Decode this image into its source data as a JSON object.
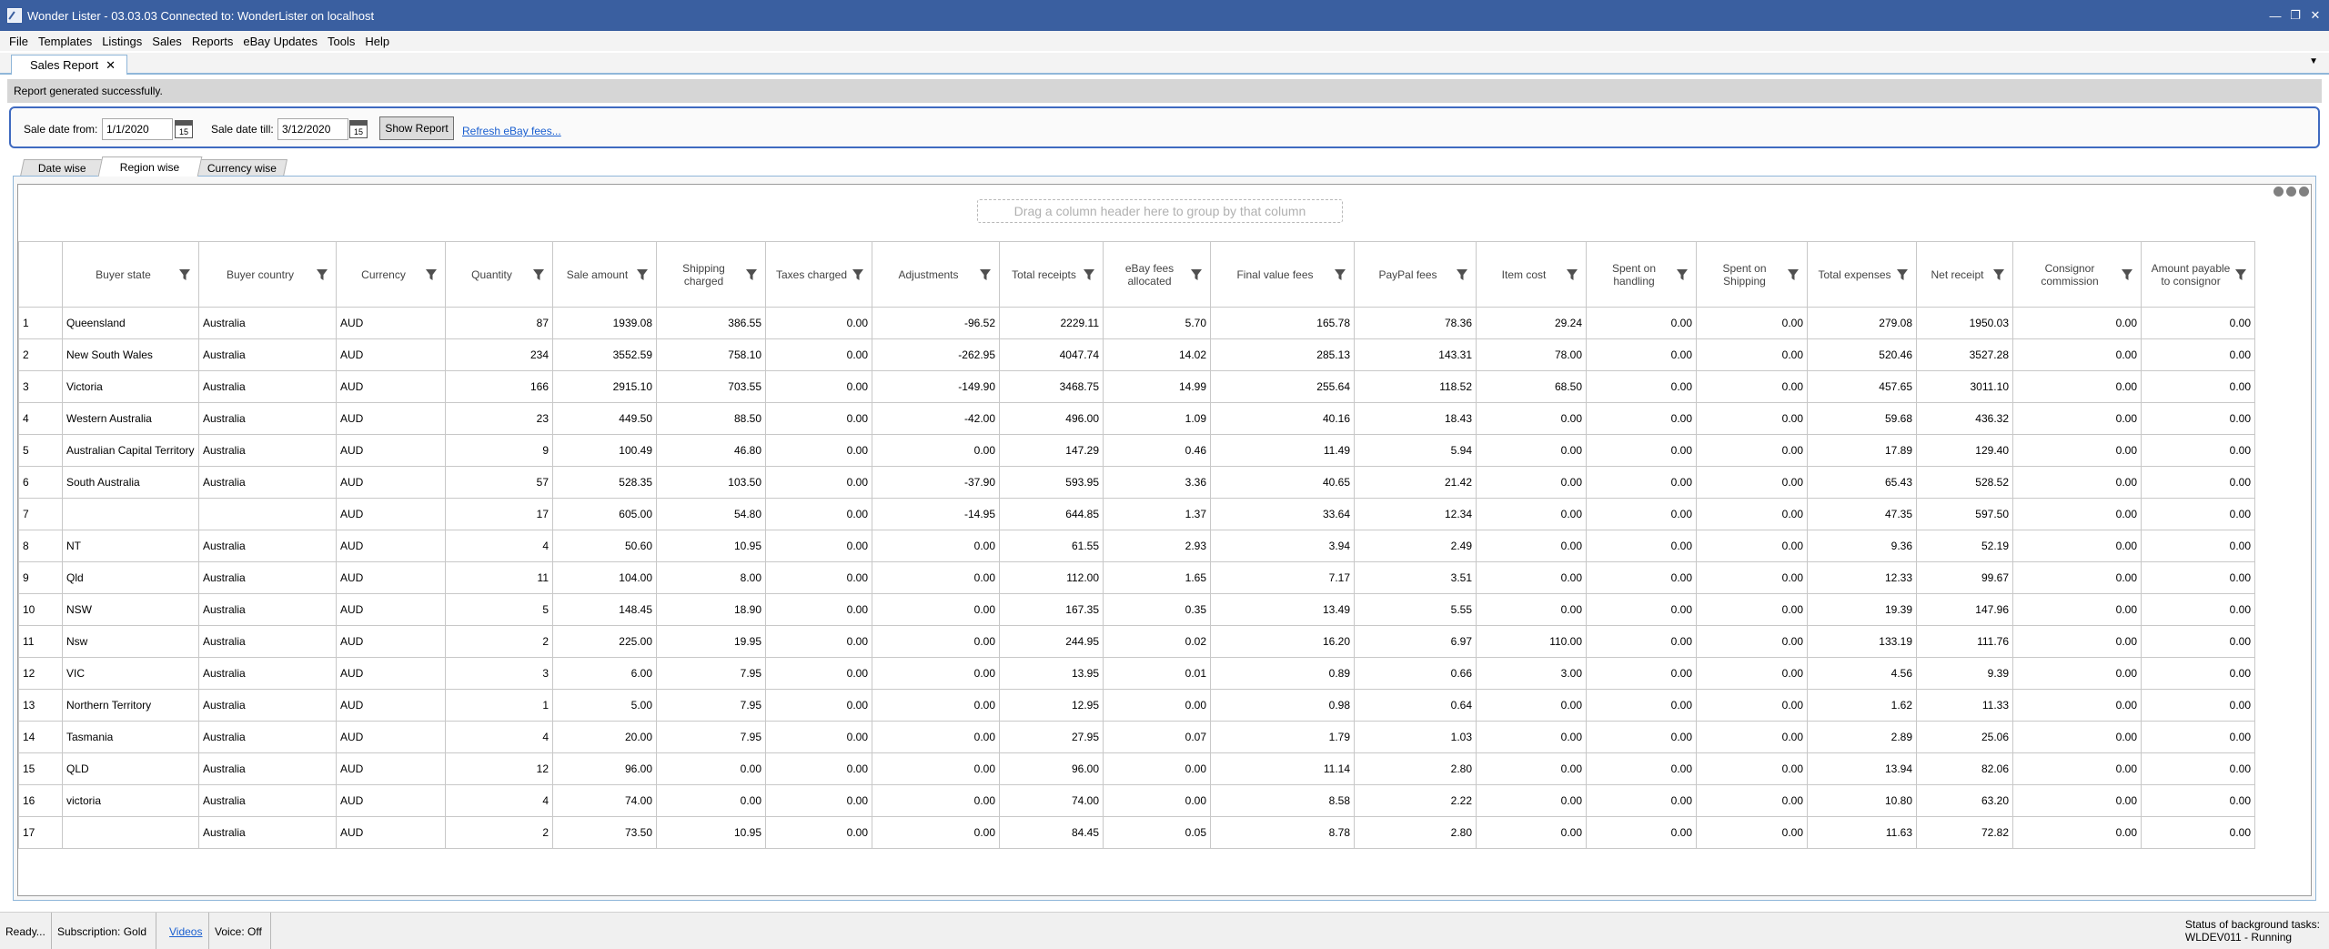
{
  "window": {
    "title": "Wonder Lister - 03.03.03 Connected to: WonderLister on localhost"
  },
  "menu": [
    "File",
    "Templates",
    "Listings",
    "Sales",
    "Reports",
    "eBay Updates",
    "Tools",
    "Help"
  ],
  "doc_tab": {
    "label": "Sales Report",
    "close": "✕"
  },
  "status_message": "Report generated successfully.",
  "filters": {
    "from_label": "Sale date from:",
    "from_value": "1/1/2020",
    "till_label": "Sale date till:",
    "till_value": "3/12/2020",
    "calendar_glyph": "15",
    "show_report": "Show Report",
    "refresh_link": "Refresh eBay fees..."
  },
  "report_tabs": [
    "Date wise",
    "Region wise",
    "Currency wise"
  ],
  "active_report_tab": "Region wise",
  "grid": {
    "group_hint": "Drag a column header here to group by that column",
    "columns": [
      "Buyer state",
      "Buyer country",
      "Currency",
      "Quantity",
      "Sale amount",
      "Shipping charged",
      "Taxes charged",
      "Adjustments",
      "Total receipts",
      "eBay fees allocated",
      "Final value fees",
      "PayPal fees",
      "Item cost",
      "Spent on handling",
      "Spent on Shipping",
      "Total expenses",
      "Net receipt",
      "Consignor commission",
      "Amount payable to consignor"
    ],
    "rows": [
      [
        "1",
        "Queensland",
        "Australia",
        "AUD",
        "87",
        "1939.08",
        "386.55",
        "0.00",
        "-96.52",
        "2229.11",
        "5.70",
        "165.78",
        "78.36",
        "29.24",
        "0.00",
        "0.00",
        "279.08",
        "1950.03",
        "0.00",
        "0.00"
      ],
      [
        "2",
        "New South Wales",
        "Australia",
        "AUD",
        "234",
        "3552.59",
        "758.10",
        "0.00",
        "-262.95",
        "4047.74",
        "14.02",
        "285.13",
        "143.31",
        "78.00",
        "0.00",
        "0.00",
        "520.46",
        "3527.28",
        "0.00",
        "0.00"
      ],
      [
        "3",
        "Victoria",
        "Australia",
        "AUD",
        "166",
        "2915.10",
        "703.55",
        "0.00",
        "-149.90",
        "3468.75",
        "14.99",
        "255.64",
        "118.52",
        "68.50",
        "0.00",
        "0.00",
        "457.65",
        "3011.10",
        "0.00",
        "0.00"
      ],
      [
        "4",
        "Western Australia",
        "Australia",
        "AUD",
        "23",
        "449.50",
        "88.50",
        "0.00",
        "-42.00",
        "496.00",
        "1.09",
        "40.16",
        "18.43",
        "0.00",
        "0.00",
        "0.00",
        "59.68",
        "436.32",
        "0.00",
        "0.00"
      ],
      [
        "5",
        "Australian Capital Territory",
        "Australia",
        "AUD",
        "9",
        "100.49",
        "46.80",
        "0.00",
        "0.00",
        "147.29",
        "0.46",
        "11.49",
        "5.94",
        "0.00",
        "0.00",
        "0.00",
        "17.89",
        "129.40",
        "0.00",
        "0.00"
      ],
      [
        "6",
        "South Australia",
        "Australia",
        "AUD",
        "57",
        "528.35",
        "103.50",
        "0.00",
        "-37.90",
        "593.95",
        "3.36",
        "40.65",
        "21.42",
        "0.00",
        "0.00",
        "0.00",
        "65.43",
        "528.52",
        "0.00",
        "0.00"
      ],
      [
        "7",
        "",
        "",
        "AUD",
        "17",
        "605.00",
        "54.80",
        "0.00",
        "-14.95",
        "644.85",
        "1.37",
        "33.64",
        "12.34",
        "0.00",
        "0.00",
        "0.00",
        "47.35",
        "597.50",
        "0.00",
        "0.00"
      ],
      [
        "8",
        "NT",
        "Australia",
        "AUD",
        "4",
        "50.60",
        "10.95",
        "0.00",
        "0.00",
        "61.55",
        "2.93",
        "3.94",
        "2.49",
        "0.00",
        "0.00",
        "0.00",
        "9.36",
        "52.19",
        "0.00",
        "0.00"
      ],
      [
        "9",
        "Qld",
        "Australia",
        "AUD",
        "11",
        "104.00",
        "8.00",
        "0.00",
        "0.00",
        "112.00",
        "1.65",
        "7.17",
        "3.51",
        "0.00",
        "0.00",
        "0.00",
        "12.33",
        "99.67",
        "0.00",
        "0.00"
      ],
      [
        "10",
        "NSW",
        "Australia",
        "AUD",
        "5",
        "148.45",
        "18.90",
        "0.00",
        "0.00",
        "167.35",
        "0.35",
        "13.49",
        "5.55",
        "0.00",
        "0.00",
        "0.00",
        "19.39",
        "147.96",
        "0.00",
        "0.00"
      ],
      [
        "11",
        "Nsw",
        "Australia",
        "AUD",
        "2",
        "225.00",
        "19.95",
        "0.00",
        "0.00",
        "244.95",
        "0.02",
        "16.20",
        "6.97",
        "110.00",
        "0.00",
        "0.00",
        "133.19",
        "111.76",
        "0.00",
        "0.00"
      ],
      [
        "12",
        "VIC",
        "Australia",
        "AUD",
        "3",
        "6.00",
        "7.95",
        "0.00",
        "0.00",
        "13.95",
        "0.01",
        "0.89",
        "0.66",
        "3.00",
        "0.00",
        "0.00",
        "4.56",
        "9.39",
        "0.00",
        "0.00"
      ],
      [
        "13",
        "Northern Territory",
        "Australia",
        "AUD",
        "1",
        "5.00",
        "7.95",
        "0.00",
        "0.00",
        "12.95",
        "0.00",
        "0.98",
        "0.64",
        "0.00",
        "0.00",
        "0.00",
        "1.62",
        "11.33",
        "0.00",
        "0.00"
      ],
      [
        "14",
        "Tasmania",
        "Australia",
        "AUD",
        "4",
        "20.00",
        "7.95",
        "0.00",
        "0.00",
        "27.95",
        "0.07",
        "1.79",
        "1.03",
        "0.00",
        "0.00",
        "0.00",
        "2.89",
        "25.06",
        "0.00",
        "0.00"
      ],
      [
        "15",
        "QLD",
        "Australia",
        "AUD",
        "12",
        "96.00",
        "0.00",
        "0.00",
        "0.00",
        "96.00",
        "0.00",
        "11.14",
        "2.80",
        "0.00",
        "0.00",
        "0.00",
        "13.94",
        "82.06",
        "0.00",
        "0.00"
      ],
      [
        "16",
        "victoria",
        "Australia",
        "AUD",
        "4",
        "74.00",
        "0.00",
        "0.00",
        "0.00",
        "74.00",
        "0.00",
        "8.58",
        "2.22",
        "0.00",
        "0.00",
        "0.00",
        "10.80",
        "63.20",
        "0.00",
        "0.00"
      ],
      [
        "17",
        "",
        "Australia",
        "AUD",
        "2",
        "73.50",
        "10.95",
        "0.00",
        "0.00",
        "84.45",
        "0.05",
        "8.78",
        "2.80",
        "0.00",
        "0.00",
        "0.00",
        "11.63",
        "72.82",
        "0.00",
        "0.00"
      ]
    ]
  },
  "statusbar": {
    "ready": "Ready...",
    "subscription": "Subscription: Gold",
    "videos": "Videos",
    "voice": "Voice:  Off",
    "bg_tasks_label": "Status of background tasks:",
    "bg_tasks_value": "WLDEV011 - Running"
  },
  "colors": {
    "titlebar": "#3a5fa0",
    "accent": "#3f6ac0",
    "link": "#1a5fd0"
  }
}
